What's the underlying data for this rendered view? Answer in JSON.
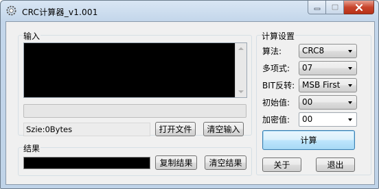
{
  "window": {
    "title": "CRC计算器_v1.001"
  },
  "input_group": {
    "label": "输入",
    "status": "Szie:0Bytes",
    "open_file_button": "打开文件",
    "clear_input_button": "清空输入"
  },
  "result_group": {
    "label": "结果",
    "copy_button": "复制结果",
    "clear_button": "清空结果"
  },
  "settings": {
    "label": "计算设置",
    "algorithm_label": "算法:",
    "algorithm_value": "CRC8",
    "polynomial_label": "多项式:",
    "polynomial_value": "07",
    "bit_reverse_label": "BIT反转:",
    "bit_reverse_value": "MSB First",
    "init_label": "初始值:",
    "init_value": "00",
    "xor_label": "加密值:",
    "xor_value": "00",
    "calc_button": "计算",
    "about_button": "关于",
    "exit_button": "退出"
  },
  "icons": {
    "app": "gear-icon",
    "minimize": "minimize-icon",
    "maximize": "maximize-icon",
    "close": "close-icon"
  },
  "colors": {
    "close_button": "#c8452c",
    "default_button_border": "#3c7fb1",
    "textbox_background": "#000000"
  }
}
